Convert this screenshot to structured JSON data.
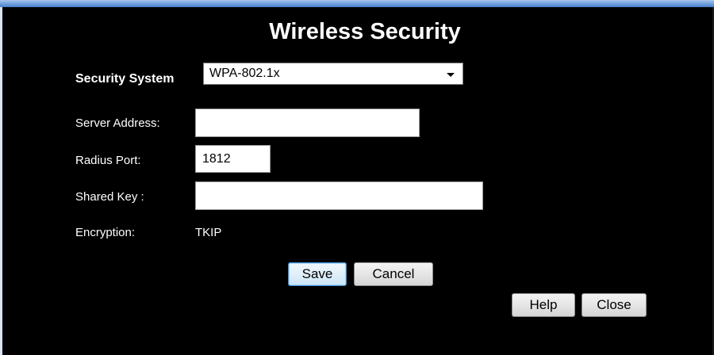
{
  "page": {
    "title": "Wireless Security"
  },
  "security": {
    "label": "Security System",
    "selected": "WPA-802.1x"
  },
  "fields": {
    "server_address": {
      "label": "Server Address:",
      "value": ""
    },
    "radius_port": {
      "label": "Radius Port:",
      "value": "1812"
    },
    "shared_key": {
      "label": "Shared Key :",
      "value": ""
    },
    "encryption": {
      "label": "Encryption:",
      "value": "TKIP"
    }
  },
  "buttons": {
    "save": "Save",
    "cancel": "Cancel",
    "help": "Help",
    "close": "Close"
  },
  "colors": {
    "background": "#000000",
    "titlebar": "#6e9fdc",
    "focus_border": "#3c8fd6"
  }
}
